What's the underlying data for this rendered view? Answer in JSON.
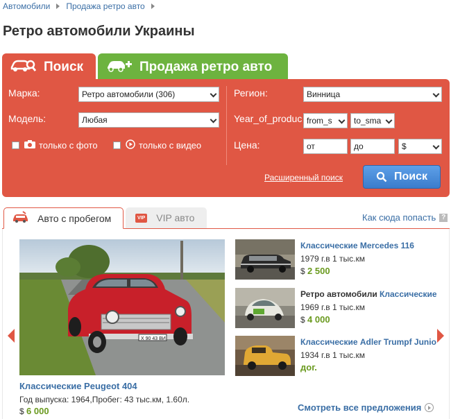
{
  "breadcrumbs": [
    "Автомобили",
    "Продажа ретро авто"
  ],
  "page_title": "Ретро автомобили Украины",
  "tabs": {
    "search": "Поиск",
    "sell": "Продажа ретро авто"
  },
  "form": {
    "brand_label": "Марка:",
    "brand_value": "Ретро автомобили (306)",
    "model_label": "Модель:",
    "model_value": "Любая",
    "photo_only": "только с фото",
    "video_only": "только с видео",
    "region_label": "Регион:",
    "region_value": "Винница",
    "year_label": "Year_of_produc",
    "year_from": "from_s",
    "year_to": "to_sma",
    "price_label": "Цена:",
    "price_from_placeholder": "от",
    "price_to_placeholder": "до",
    "currency": "$",
    "advanced_link": "Расширенный поиск",
    "search_button": "Поиск"
  },
  "listing_tabs": {
    "used": "Авто с пробегом",
    "vip_badge": "VIP",
    "vip": "VIP авто",
    "how_to_get": "Как сюда попасть",
    "help": "?"
  },
  "featured": {
    "title": "Классические Peugeot 404",
    "description": "Год выпуска: 1964,Пробег: 43 тыс.км, 1.60л.",
    "currency": "$",
    "price": "6 000",
    "plate": "Х 90 43 ВИ"
  },
  "side_items": [
    {
      "title_plain": "",
      "title_link": "Классические Mercedes 116",
      "sub": "1979 г.в 1 тыс.км",
      "currency": "$",
      "price": "2 500"
    },
    {
      "title_plain": "Ретро автомобили ",
      "title_link": "Классические",
      "sub": "1969 г.в 1 тыс.км",
      "currency": "$",
      "price": "4 000"
    },
    {
      "title_plain": "",
      "title_link": "Классические Adler Trumpf Junio",
      "sub": "1934 г.в 1 тыс.км",
      "currency": "",
      "price": "дог."
    }
  ],
  "see_all": "Смотреть все предложения",
  "colors": {
    "accent_red": "#e05744",
    "accent_green": "#6db33f",
    "link_blue": "#3a6ea5",
    "button_blue": "#3a7ccc",
    "price_green": "#6a9a1f"
  }
}
